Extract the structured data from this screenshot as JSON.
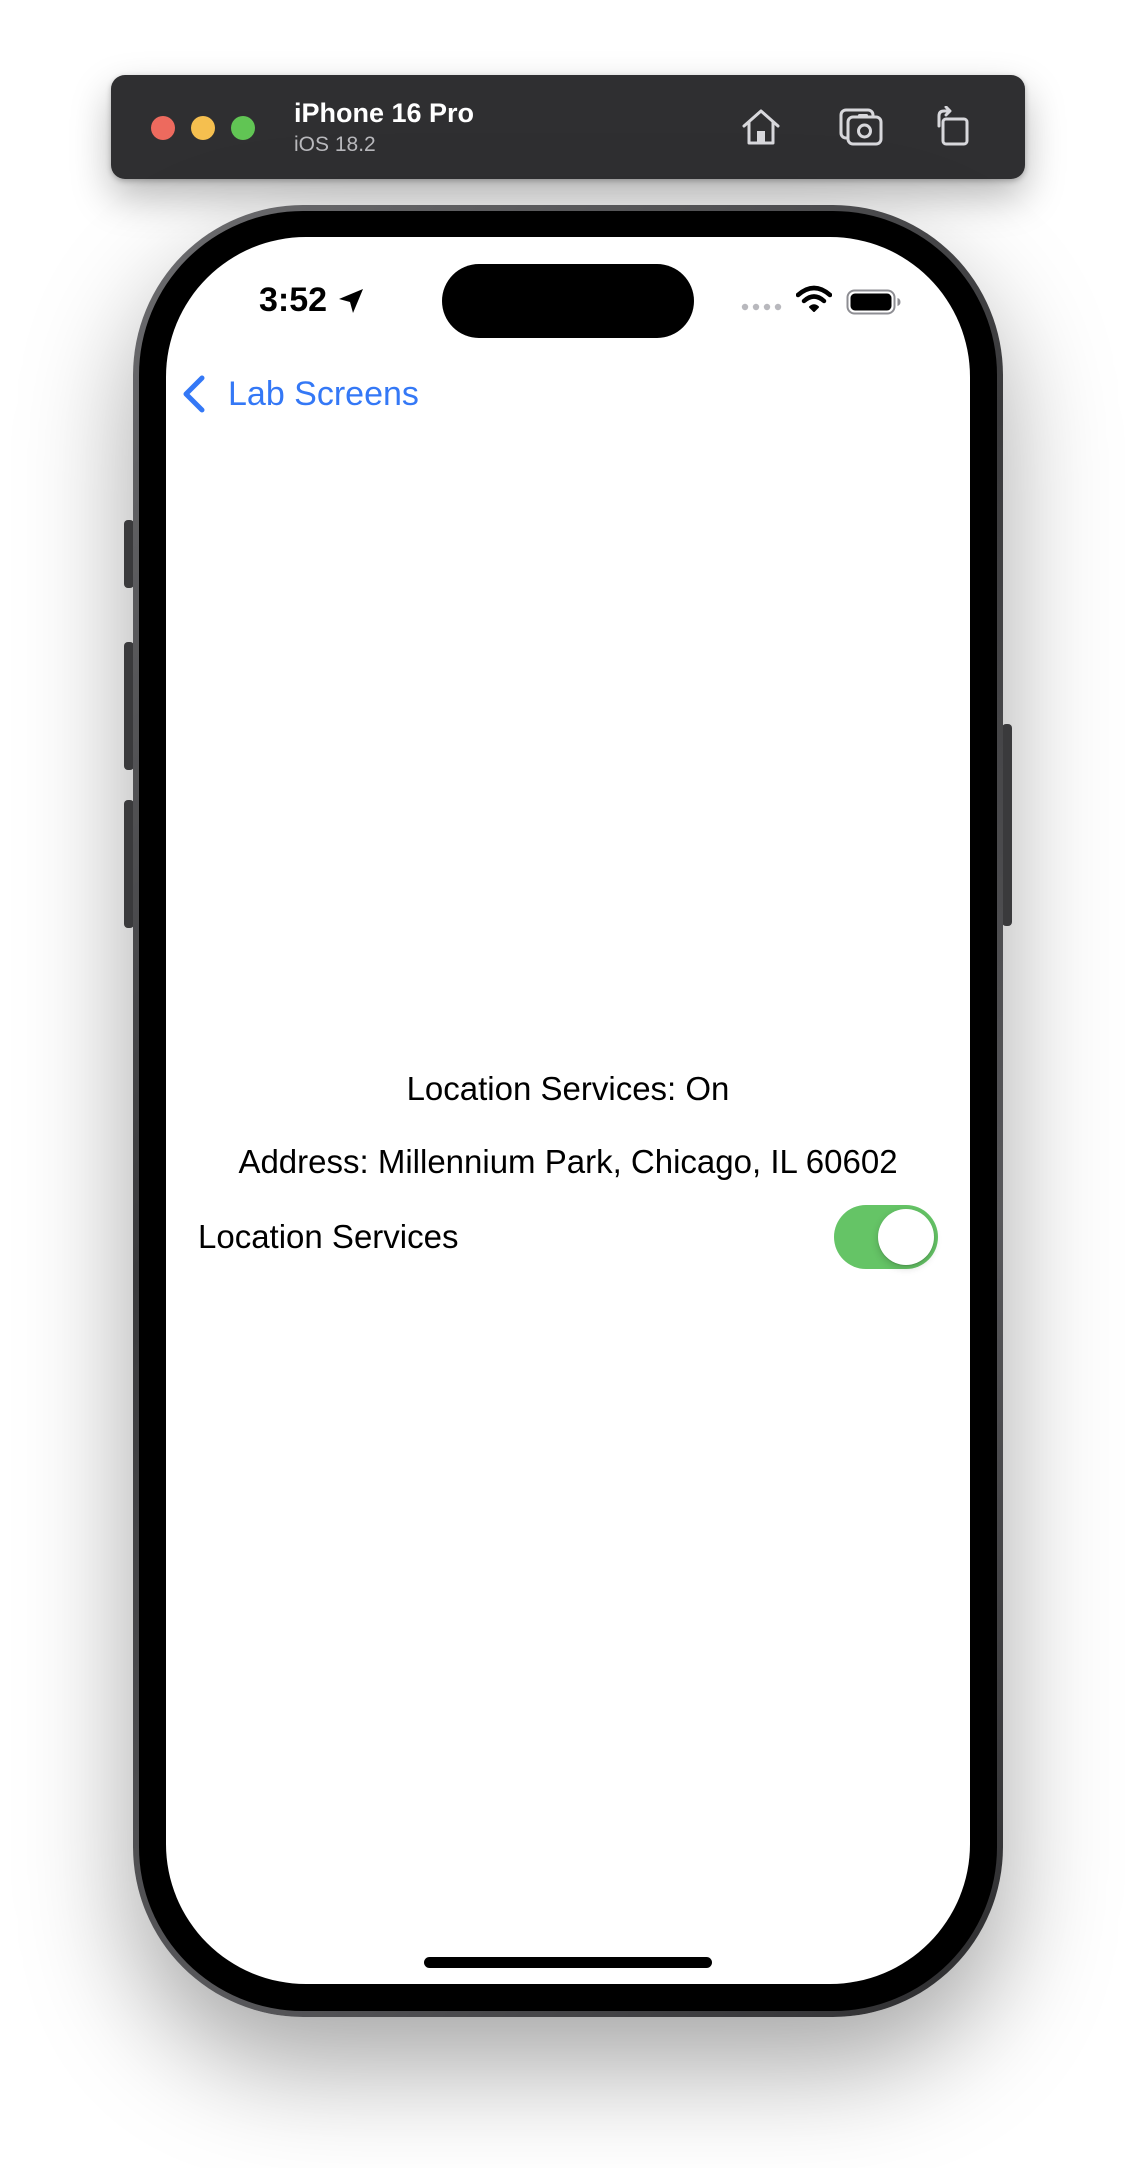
{
  "simulator": {
    "device_name": "iPhone 16 Pro",
    "os_version": "iOS 18.2",
    "toolbar_buttons": [
      "home-icon",
      "screenshot-icon",
      "rotate-icon"
    ]
  },
  "status_bar": {
    "time": "3:52",
    "location_active": true
  },
  "nav": {
    "back_label": "Lab Screens"
  },
  "content": {
    "location_status": "Location Services: On",
    "address": "Address: Millennium Park, Chicago, IL 60602",
    "toggle_label": "Location Services",
    "toggle_on": true
  },
  "colors": {
    "accent": "#3478f6",
    "toggle_on": "#65c466",
    "traffic_close": "#ed6a5e",
    "traffic_min": "#f5bf4f",
    "traffic_max": "#61c554"
  }
}
